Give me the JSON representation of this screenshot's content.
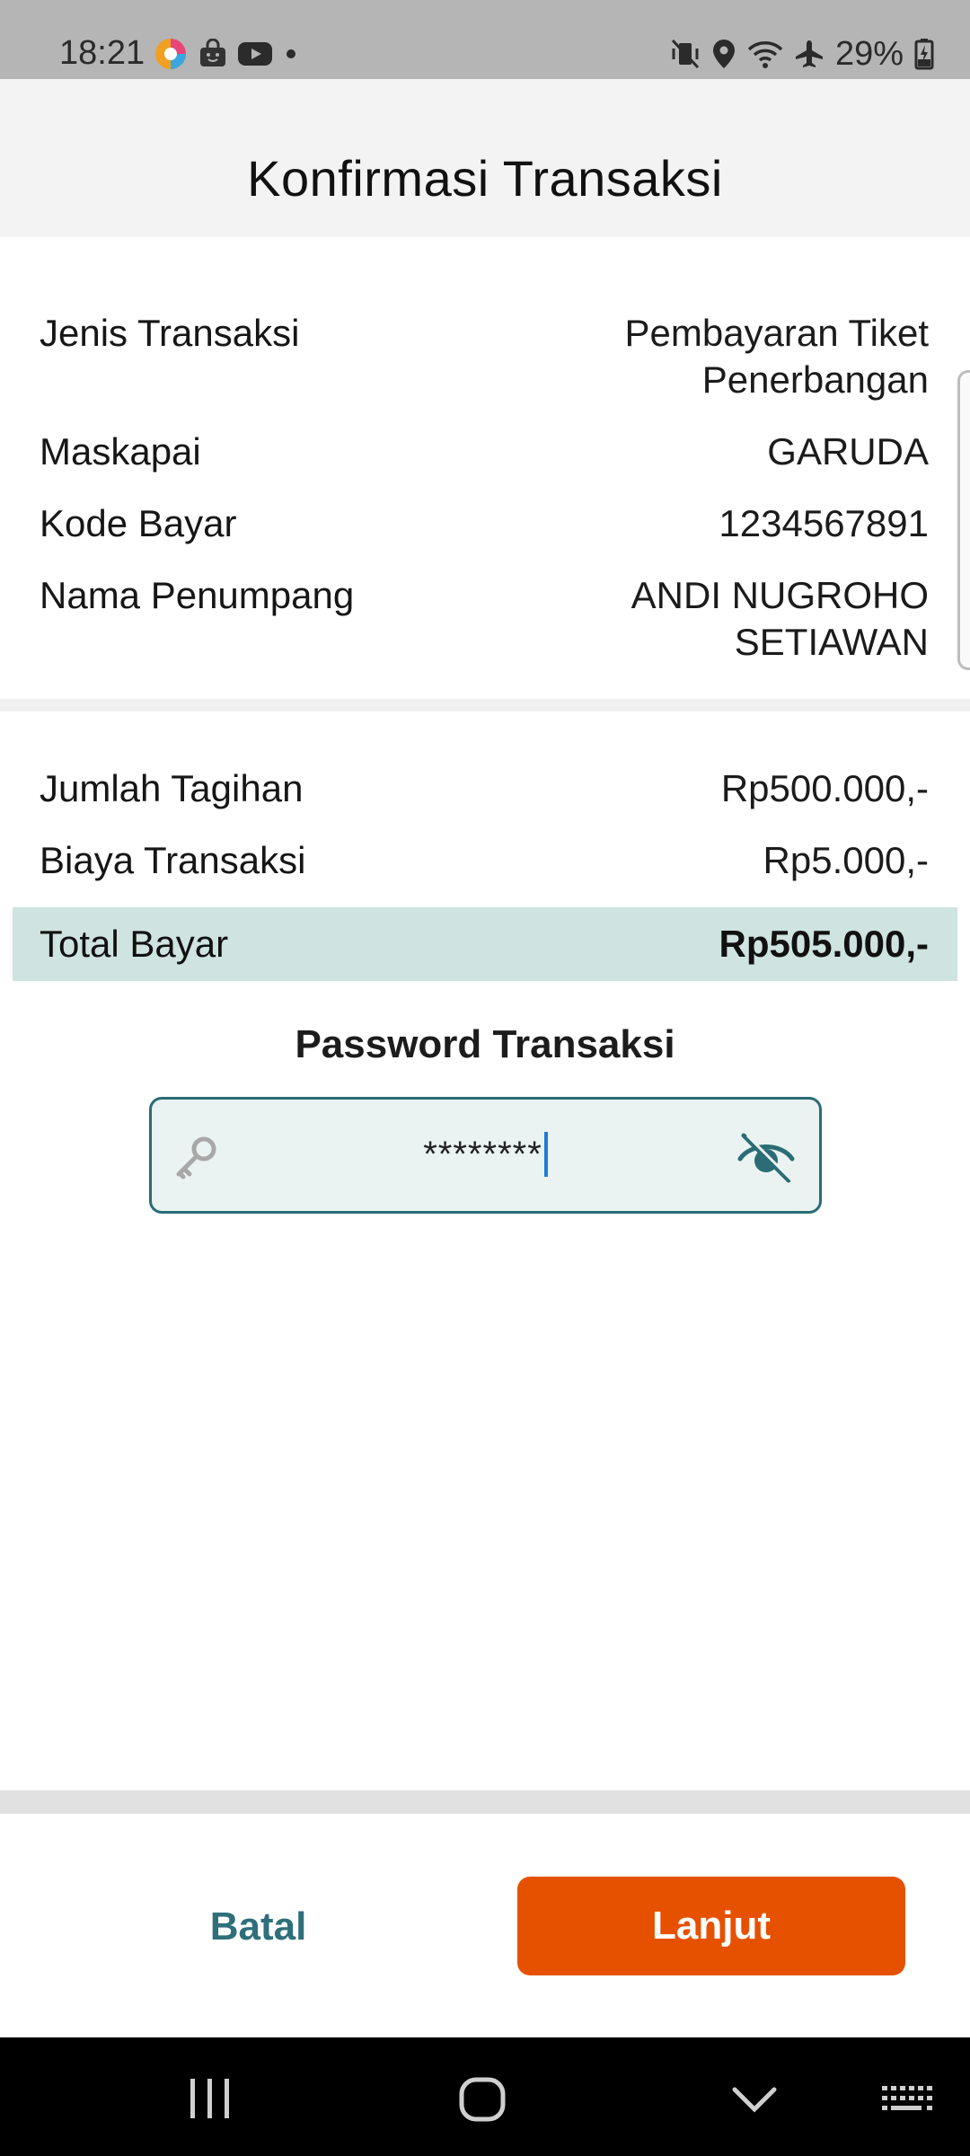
{
  "status_bar": {
    "time": "18:21",
    "battery": "29%",
    "left_icons": [
      "browser-app-icon",
      "shopping-bag-icon",
      "youtube-icon",
      "dot-icon"
    ],
    "right_icons": [
      "vibrate-mute-icon",
      "location-icon",
      "wifi-icon",
      "airplane-mode-icon",
      "battery-charging-icon"
    ]
  },
  "header": {
    "title": "Konfirmasi Transaksi"
  },
  "details": [
    {
      "label": "Jenis Transaksi",
      "value": "Pembayaran Tiket Penerbangan"
    },
    {
      "label": "Maskapai",
      "value": "GARUDA"
    },
    {
      "label": "Kode Bayar",
      "value": "1234567891"
    },
    {
      "label": "Nama Penumpang",
      "value": "ANDI NUGROHO SETIAWAN"
    }
  ],
  "billing": [
    {
      "label": "Jumlah Tagihan",
      "value": "Rp500.000,-"
    },
    {
      "label": "Biaya Transaksi",
      "value": "Rp5.000,-"
    }
  ],
  "total": {
    "label": "Total Bayar",
    "value": "Rp505.000,-"
  },
  "password": {
    "title": "Password Transaksi",
    "value": "********"
  },
  "actions": {
    "cancel_label": "Batal",
    "next_label": "Lanjut"
  },
  "colors": {
    "accent": "#2f6f7a",
    "primary_button": "#e65100",
    "total_highlight": "#cfe3e0",
    "input_background": "#eaf3f1"
  }
}
